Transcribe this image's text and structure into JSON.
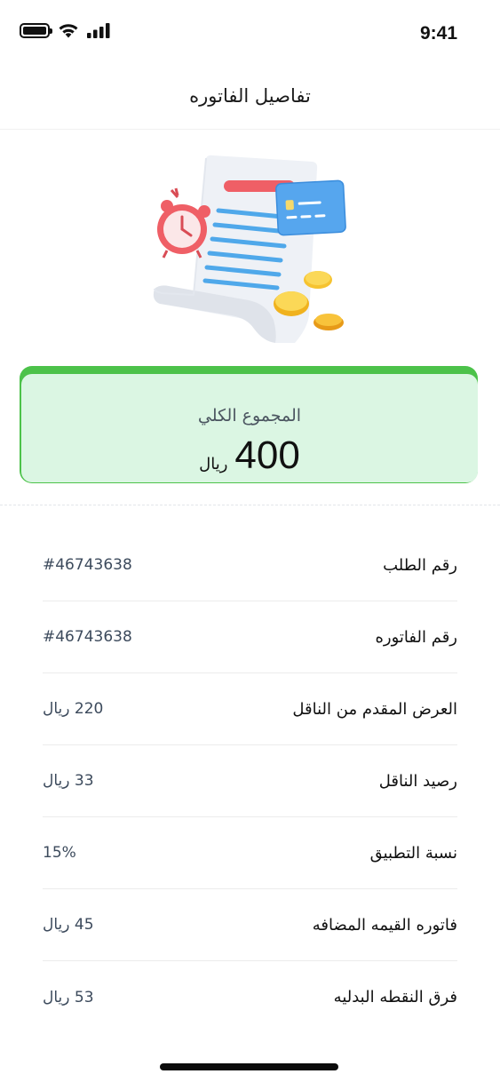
{
  "status_bar": {
    "time": "9:41"
  },
  "header": {
    "title": "تفاصيل الفاتوره"
  },
  "total": {
    "label": "المجموع الكلي",
    "amount": "400",
    "currency": "ريال"
  },
  "details": [
    {
      "label": "رقم الطلب",
      "value": "#46743638"
    },
    {
      "label": "رقم الفاتوره",
      "value": "#46743638"
    },
    {
      "label": "العرض المقدم من الناقل",
      "value": "220 ريال"
    },
    {
      "label": "رصيد الناقل",
      "value": "33 ريال"
    },
    {
      "label": "نسبة التطبيق",
      "value": "15%"
    },
    {
      "label": "فاتوره القيمه المضافه",
      "value": "45 ريال"
    },
    {
      "label": "فرق النقطه البدليه",
      "value": "53 ريال"
    }
  ],
  "colors": {
    "accent_green": "#4cc24a",
    "card_bg": "#dbf6e3",
    "value_text": "#3c4a5c"
  },
  "icons": [
    "battery-icon",
    "wifi-icon",
    "cellular-signal-icon",
    "invoice-illustration"
  ]
}
